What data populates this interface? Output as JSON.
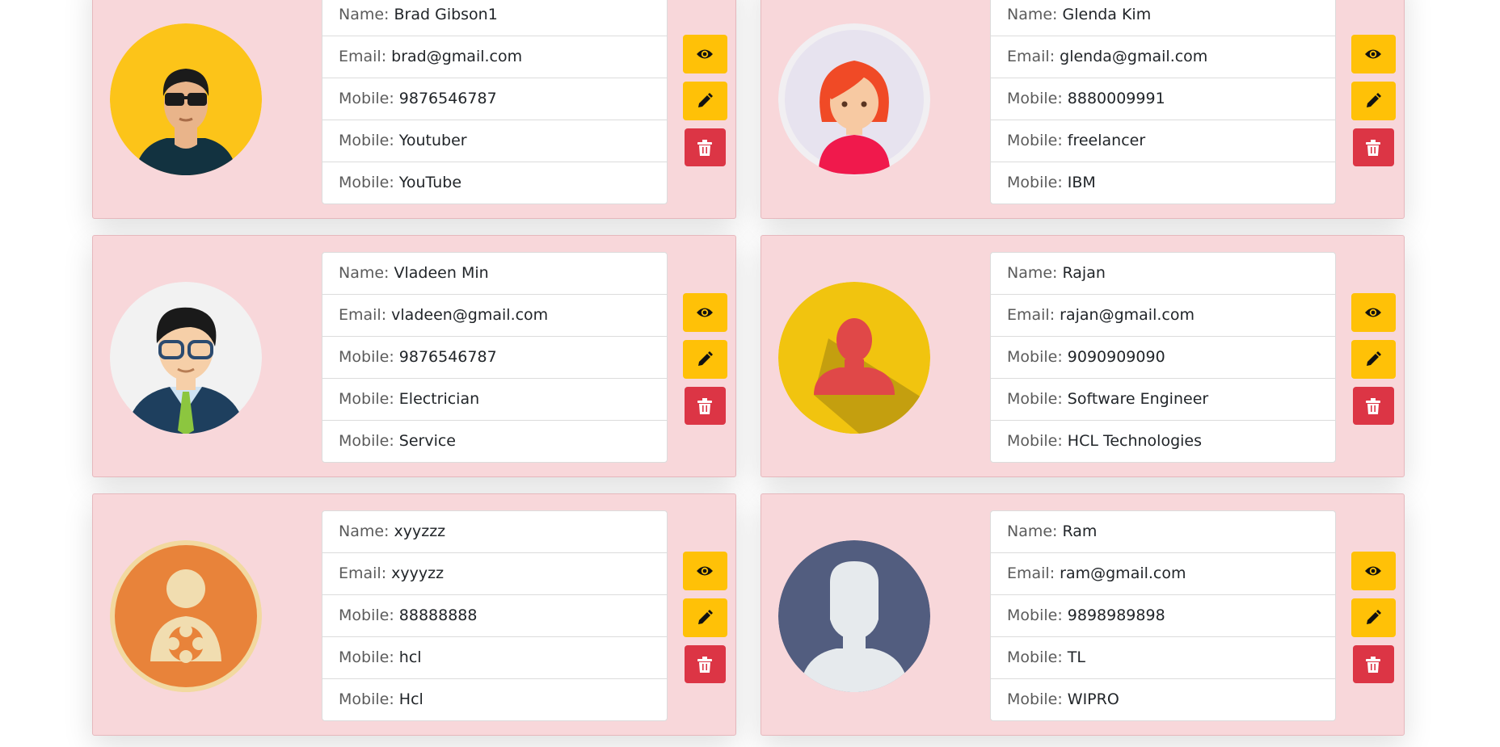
{
  "colors": {
    "card_bg": "#f8d7da",
    "view_button": "#ffc107",
    "edit_button": "#ffc107",
    "delete_button": "#dc3545"
  },
  "labels": {
    "name": "Name: ",
    "email": "Email: ",
    "mobile": "Mobile: ",
    "title": "Mobile: ",
    "company": "Mobile: "
  },
  "icons": {
    "view": "eye-icon",
    "edit": "pencil-icon",
    "delete": "trash-icon"
  },
  "contacts": [
    {
      "avatar": "man-sunglasses-avatar",
      "name": "Brad Gibson1",
      "email": "brad@gmail.com",
      "mobile": "9876546787",
      "title": "Youtuber",
      "company": "YouTube"
    },
    {
      "avatar": "woman-red-hair-avatar",
      "name": "Glenda Kim",
      "email": "glenda@gmail.com",
      "mobile": "8880009991",
      "title": "freelancer",
      "company": "IBM"
    },
    {
      "avatar": "man-glasses-suit-avatar",
      "name": "Vladeen Min",
      "email": "vladeen@gmail.com",
      "mobile": "9876546787",
      "title": "Electrician",
      "company": "Service"
    },
    {
      "avatar": "red-silhouette-avatar",
      "name": "Rajan",
      "email": "rajan@gmail.com",
      "mobile": "9090909090",
      "title": "Software Engineer",
      "company": "HCL Technologies"
    },
    {
      "avatar": "orange-flower-user-avatar",
      "name": "xyyzzz",
      "email": "xyyyzz",
      "mobile": "88888888",
      "title": "hcl",
      "company": "Hcl"
    },
    {
      "avatar": "grey-silhouette-avatar",
      "name": "Ram",
      "email": "ram@gmail.com",
      "mobile": "9898989898",
      "title": "TL",
      "company": "WIPRO"
    }
  ]
}
